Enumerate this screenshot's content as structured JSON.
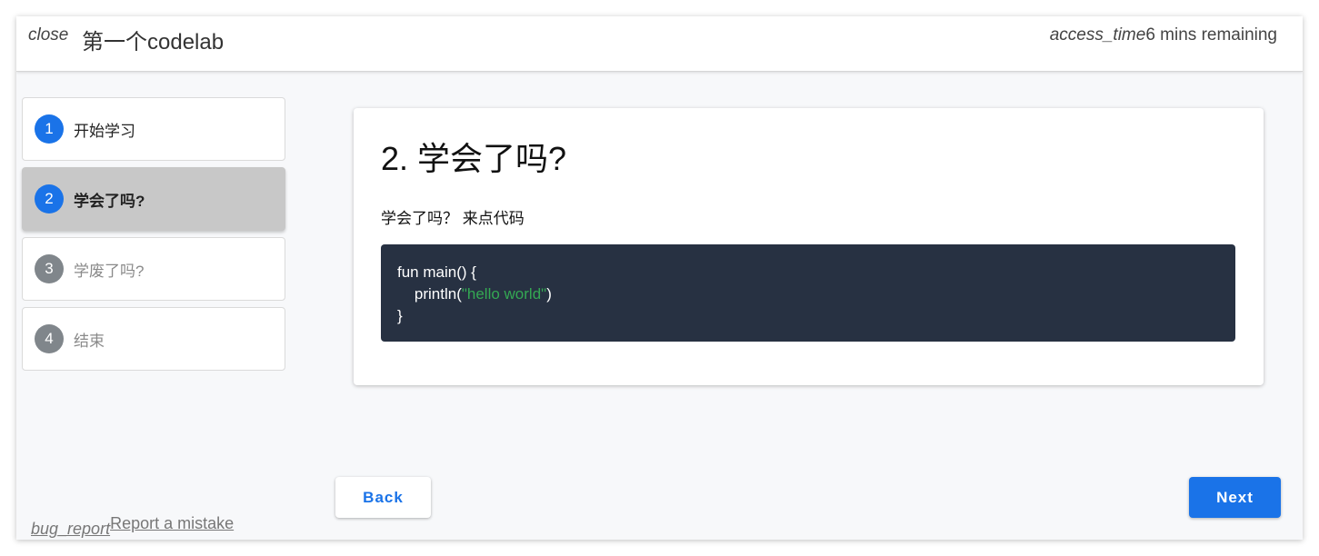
{
  "header": {
    "close_icon": "close",
    "title": "第一个codelab",
    "time_icon": "access_time",
    "time_remaining": "6 mins remaining"
  },
  "steps": [
    {
      "number": "1",
      "label": "开始学习",
      "state": "done"
    },
    {
      "number": "2",
      "label": "学会了吗?",
      "state": "active"
    },
    {
      "number": "3",
      "label": "学废了吗?",
      "state": "todo"
    },
    {
      "number": "4",
      "label": "结束",
      "state": "todo"
    }
  ],
  "content": {
    "title": "2. 学会了吗?",
    "text": "学会了吗？ 来点代码",
    "code": {
      "line1": "fun main() {",
      "line2_prefix": "    println(",
      "line2_string": "\"hello world\"",
      "line2_suffix": ")",
      "line3": "}"
    }
  },
  "nav": {
    "back_label": "Back",
    "next_label": "Next"
  },
  "footer": {
    "bug_icon": "bug_report",
    "report_label": "Report a mistake"
  },
  "colors": {
    "accent": "#1a73e8",
    "active_step_bg": "#c8c8c8",
    "code_bg": "#273142",
    "string_color": "#34a853"
  }
}
